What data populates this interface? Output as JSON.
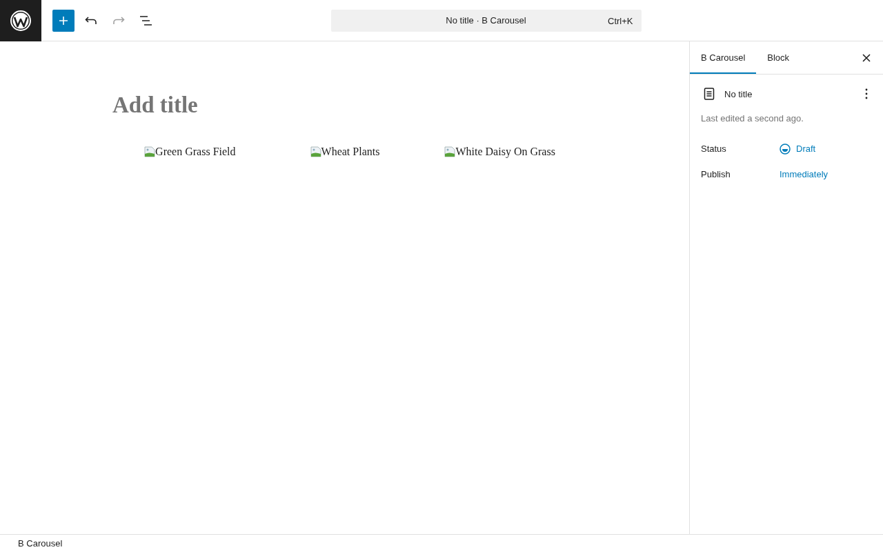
{
  "toolbar": {
    "buttons": [
      {
        "kind": "add",
        "disabled": false
      },
      {
        "kind": "undo",
        "disabled": false
      },
      {
        "kind": "redo",
        "disabled": true
      },
      {
        "kind": "outline",
        "disabled": false
      }
    ]
  },
  "command_bar": {
    "title": "No title · B Carousel",
    "shortcut": "Ctrl+K"
  },
  "editor": {
    "title_field": {
      "placeholder": "Add title"
    },
    "slides": [
      {
        "alt": "Green Grass Field"
      },
      {
        "alt": "Wheat Plants"
      },
      {
        "alt": "White Daisy On Grass"
      }
    ]
  },
  "sidebar": {
    "tabs": [
      {
        "label": "B Carousel",
        "selected": true
      },
      {
        "label": "Block",
        "selected": false
      }
    ],
    "document": {
      "title": "No title",
      "last_edited": "Last edited a second ago."
    },
    "fields": [
      {
        "kind": "status",
        "label": "Status",
        "value": "Draft"
      },
      {
        "kind": "link",
        "label": "Publish",
        "value": "Immediately"
      }
    ]
  },
  "footer": {
    "breadcrumb": "B Carousel"
  }
}
